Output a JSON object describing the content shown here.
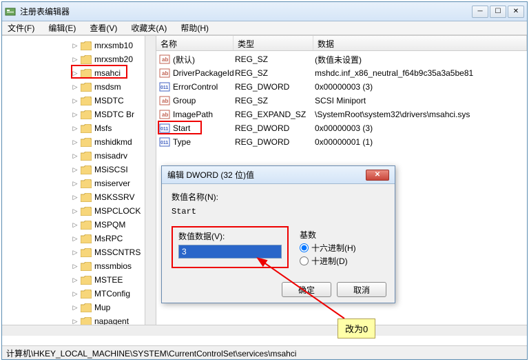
{
  "window": {
    "title": "注册表编辑器",
    "min_glyph": "─",
    "max_glyph": "☐",
    "close_glyph": "✕"
  },
  "menu": {
    "file": "文件(F)",
    "edit": "编辑(E)",
    "view": "查看(V)",
    "favorites": "收藏夹(A)",
    "help": "帮助(H)"
  },
  "tree": {
    "items": [
      "mrxsmb10",
      "mrxsmb20",
      "msahci",
      "msdsm",
      "MSDTC",
      "MSDTC Br",
      "Msfs",
      "mshidkmd",
      "msisadrv",
      "MSiSCSI",
      "msiserver",
      "MSKSSRV",
      "MSPCLOCK",
      "MSPQM",
      "MsRPC",
      "MSSCNTRS",
      "mssmbios",
      "MSTEE",
      "MTConfig",
      "Mup",
      "napagent"
    ],
    "highlight_index": 2
  },
  "list": {
    "headers": {
      "name": "名称",
      "type": "类型",
      "data": "数据"
    },
    "rows": [
      {
        "icon": "sz",
        "name": "(默认)",
        "type": "REG_SZ",
        "data": "(数值未设置)"
      },
      {
        "icon": "sz",
        "name": "DriverPackageId",
        "type": "REG_SZ",
        "data": "mshdc.inf_x86_neutral_f64b9c35a3a5be81"
      },
      {
        "icon": "dw",
        "name": "ErrorControl",
        "type": "REG_DWORD",
        "data": "0x00000003 (3)"
      },
      {
        "icon": "sz",
        "name": "Group",
        "type": "REG_SZ",
        "data": "SCSI Miniport"
      },
      {
        "icon": "sz",
        "name": "ImagePath",
        "type": "REG_EXPAND_SZ",
        "data": "\\SystemRoot\\system32\\drivers\\msahci.sys"
      },
      {
        "icon": "dw",
        "name": "Start",
        "type": "REG_DWORD",
        "data": "0x00000003 (3)"
      },
      {
        "icon": "dw",
        "name": "Type",
        "type": "REG_DWORD",
        "data": "0x00000001 (1)"
      }
    ],
    "highlight_index": 5
  },
  "dialog": {
    "title": "编辑 DWORD (32 位)值",
    "name_label": "数值名称(N):",
    "name_value": "Start",
    "value_label": "数值数据(V):",
    "value_value": "3",
    "base_label": "基数",
    "hex_label": "十六进制(H)",
    "dec_label": "十进制(D)",
    "hex_checked": true,
    "ok": "确定",
    "cancel": "取消"
  },
  "statusbar": "计算机\\HKEY_LOCAL_MACHINE\\SYSTEM\\CurrentControlSet\\services\\msahci",
  "annotation": {
    "text": "改为0"
  }
}
